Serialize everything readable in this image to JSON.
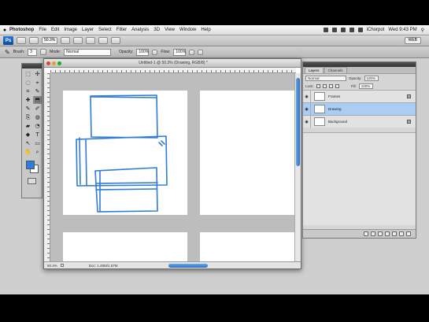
{
  "menubar": {
    "apple": "",
    "app_name": "Photoshop",
    "items": [
      "File",
      "Edit",
      "Image",
      "Layer",
      "Select",
      "Filter",
      "Analysis",
      "3D",
      "View",
      "Window",
      "Help"
    ],
    "status_user": "iChorpot",
    "clock": "Wed 9:43 PM"
  },
  "appbar": {
    "logo": "Ps",
    "zoom": "50.3%",
    "workspace": "WEB"
  },
  "options": {
    "brush_label": "Brush:",
    "brush_size": "3",
    "mode_label": "Mode:",
    "mode_value": "Normal",
    "opacity_label": "Opacity:",
    "opacity_value": "100%",
    "flow_label": "Flow:",
    "flow_value": "100%"
  },
  "tools": [
    "⬚",
    "✣",
    "◌",
    "⌖",
    "⌗",
    "✎",
    "✚",
    "⬒",
    "✎",
    "✐",
    "⎘",
    "◍",
    "▰",
    "◔",
    "◆",
    "T",
    "↖",
    "▭",
    "✋",
    "⌕"
  ],
  "document": {
    "title": "Untitled-1 @ 50.3% (Drawing, RGB/8) *",
    "zoom_status": "50.3%",
    "doc_info": "Doc: 1.49M/1.57M"
  },
  "colors": {
    "foreground": "#2a7de1",
    "background": "#ffffff",
    "stroke": "#2f7bd6",
    "selection": "#a9cdf3"
  },
  "layers_panel": {
    "tabs": [
      "Layers",
      "Channels"
    ],
    "blend_mode": "Normal",
    "opacity_label": "Opacity:",
    "opacity_value": "100%",
    "lock_label": "Lock:",
    "fill_label": "Fill:",
    "fill_value": "100%",
    "layers": [
      {
        "name": "Frames",
        "visible": true,
        "selected": false,
        "locked": true
      },
      {
        "name": "Drawing",
        "visible": true,
        "selected": true,
        "locked": false
      },
      {
        "name": "Background",
        "visible": true,
        "selected": false,
        "locked": true
      }
    ]
  }
}
